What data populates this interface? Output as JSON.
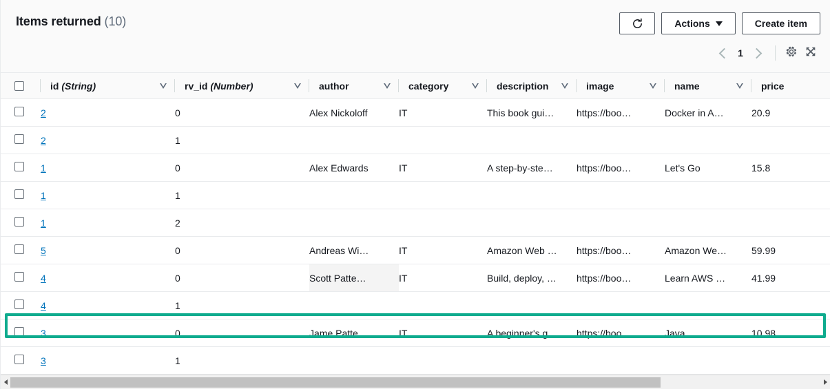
{
  "header": {
    "title": "Items returned",
    "count": "(10)",
    "refresh_icon": "refresh-icon",
    "actions_label": "Actions",
    "create_label": "Create item"
  },
  "pagination": {
    "prev_icon": "chevron-left-icon",
    "page_number": "1",
    "next_icon": "chevron-right-icon",
    "settings_icon": "gear-icon",
    "fullscreen_icon": "expand-icon"
  },
  "table": {
    "columns": [
      {
        "label": "id",
        "type": "(String)",
        "sortable": true
      },
      {
        "label": "rv_id",
        "type": "(Number)",
        "sortable": true
      },
      {
        "label": "author",
        "type": "",
        "sortable": true
      },
      {
        "label": "category",
        "type": "",
        "sortable": true
      },
      {
        "label": "description",
        "type": "",
        "sortable": true
      },
      {
        "label": "image",
        "type": "",
        "sortable": true
      },
      {
        "label": "name",
        "type": "",
        "sortable": true
      },
      {
        "label": "price",
        "type": "",
        "sortable": false
      }
    ],
    "rows": [
      {
        "id": "2",
        "rv_id": "0",
        "author": "Alex Nickoloff",
        "category": "IT",
        "description": "This book gui…",
        "image": "https://boo…",
        "name": "Docker in A…",
        "price": "20.9"
      },
      {
        "id": "2",
        "rv_id": "1",
        "author": "",
        "category": "",
        "description": "",
        "image": "",
        "name": "",
        "price": ""
      },
      {
        "id": "1",
        "rv_id": "0",
        "author": "Alex Edwards",
        "category": "IT",
        "description": "A step-by-ste…",
        "image": "https://boo…",
        "name": "Let's Go",
        "price": "15.8"
      },
      {
        "id": "1",
        "rv_id": "1",
        "author": "",
        "category": "",
        "description": "",
        "image": "",
        "name": "",
        "price": ""
      },
      {
        "id": "1",
        "rv_id": "2",
        "author": "",
        "category": "",
        "description": "",
        "image": "",
        "name": "",
        "price": ""
      },
      {
        "id": "5",
        "rv_id": "0",
        "author": "Andreas Wi…",
        "category": "IT",
        "description": "Amazon Web …",
        "image": "https://boo…",
        "name": "Amazon We…",
        "price": "59.99",
        "highlighted": true
      },
      {
        "id": "4",
        "rv_id": "0",
        "author": "Scott Patte…",
        "category": "IT",
        "description": "Build, deploy, …",
        "image": "https://boo…",
        "name": "Learn AWS …",
        "price": "41.99",
        "author_hover": true
      },
      {
        "id": "4",
        "rv_id": "1",
        "author": "",
        "category": "",
        "description": "",
        "image": "",
        "name": "",
        "price": ""
      },
      {
        "id": "3",
        "rv_id": "0",
        "author": "Jame Patte…",
        "category": "IT",
        "description": "A beginner's g…",
        "image": "https://boo…",
        "name": "Java",
        "price": "10.98"
      },
      {
        "id": "3",
        "rv_id": "1",
        "author": "",
        "category": "",
        "description": "",
        "image": "",
        "name": "",
        "price": ""
      }
    ]
  },
  "scrollbar": {
    "left_arrow_icon": "triangle-left-icon",
    "right_arrow_icon": "triangle-right-icon"
  },
  "colors": {
    "highlight": "#0eab8e",
    "link": "#0073bb",
    "header_bg": "#fafafa"
  }
}
